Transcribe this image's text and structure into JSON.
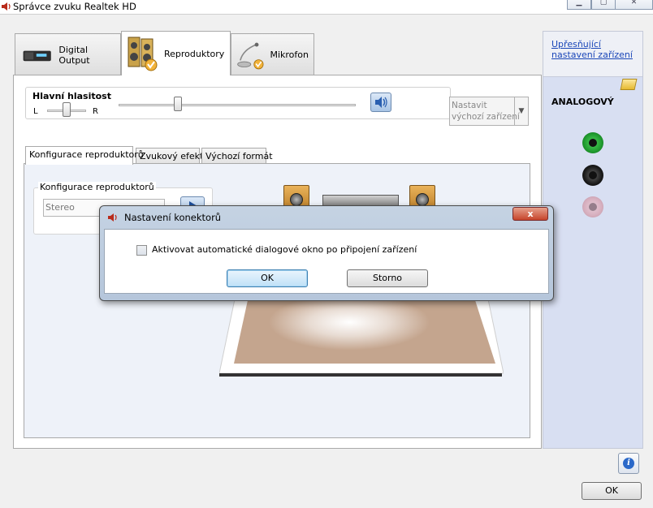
{
  "window": {
    "title": "Správce zvuku Realtek HD"
  },
  "main_tabs": [
    {
      "label": "Digital Output"
    },
    {
      "label": "Reproduktory"
    },
    {
      "label": "Mikrofon"
    }
  ],
  "volume": {
    "title": "Hlavní hlasitost",
    "left_label": "L",
    "right_label": "R",
    "balance_level": 0.5,
    "master_level": 0.25
  },
  "default_device": {
    "label_line1": "Nastavit",
    "label_line2": "výchozí zařízení"
  },
  "sub_tabs": [
    {
      "label": "Konfigurace reproduktorů"
    },
    {
      "label": "Zvukový efekt"
    },
    {
      "label": "Výchozí formát"
    }
  ],
  "speaker_config": {
    "group_label": "Konfigurace reproduktorů",
    "selected": "Stereo"
  },
  "right_panel": {
    "link_line1": "Upřesňující",
    "link_line2": "nastavení zařízení",
    "section_label": "ANALOGOVÝ",
    "jacks": [
      {
        "color": "#1f9a2e"
      },
      {
        "color": "#1a1a1a"
      },
      {
        "color": "#d69aa8"
      }
    ]
  },
  "footer": {
    "ok_label": "OK"
  },
  "dialog": {
    "title": "Nastavení konektorů",
    "close_label": "x",
    "checkbox_label": "Aktivovat automatické dialogové okno po připojení zařízení",
    "checkbox_checked": false,
    "ok_label": "OK",
    "cancel_label": "Storno"
  }
}
